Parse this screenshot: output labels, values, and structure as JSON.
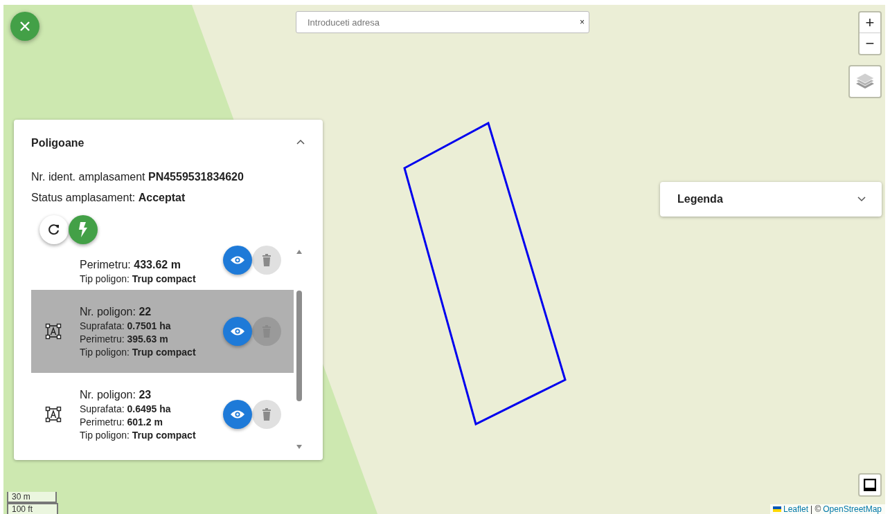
{
  "search": {
    "placeholder": "Introduceti adresa",
    "clear": "×"
  },
  "zoom": {
    "in": "+",
    "out": "−"
  },
  "panel": {
    "title": "Poligoane",
    "expanded": true,
    "ident": "Nr. ident. amplasament **PN4559531834620**",
    "status": "Status amplasament: **Acceptat**",
    "polygons": [
      {
        "selected": false,
        "lines": [
          "Perimetru: **433.62 m**",
          "Tip poligon: **Trup compact**"
        ]
      },
      {
        "selected": true,
        "lines": [
          "Nr. poligon: **22**",
          "Suprafata: **0.7501 ha**",
          "Perimetru: **395.63 m**",
          "Tip poligon: **Trup compact**"
        ]
      },
      {
        "selected": false,
        "lines": [
          "Nr. poligon: **23**",
          "Suprafata: **0.6495 ha**",
          "Perimetru: **601.2 m**",
          "Tip poligon: **Trup compact**"
        ]
      }
    ]
  },
  "legend": {
    "title": "Legenda",
    "expanded": false
  },
  "scale": [
    "30 m",
    "100 ft"
  ],
  "attribution": {
    "leaflet": "Leaflet",
    "separator": "| ©",
    "osm": "OpenStreetMap"
  }
}
